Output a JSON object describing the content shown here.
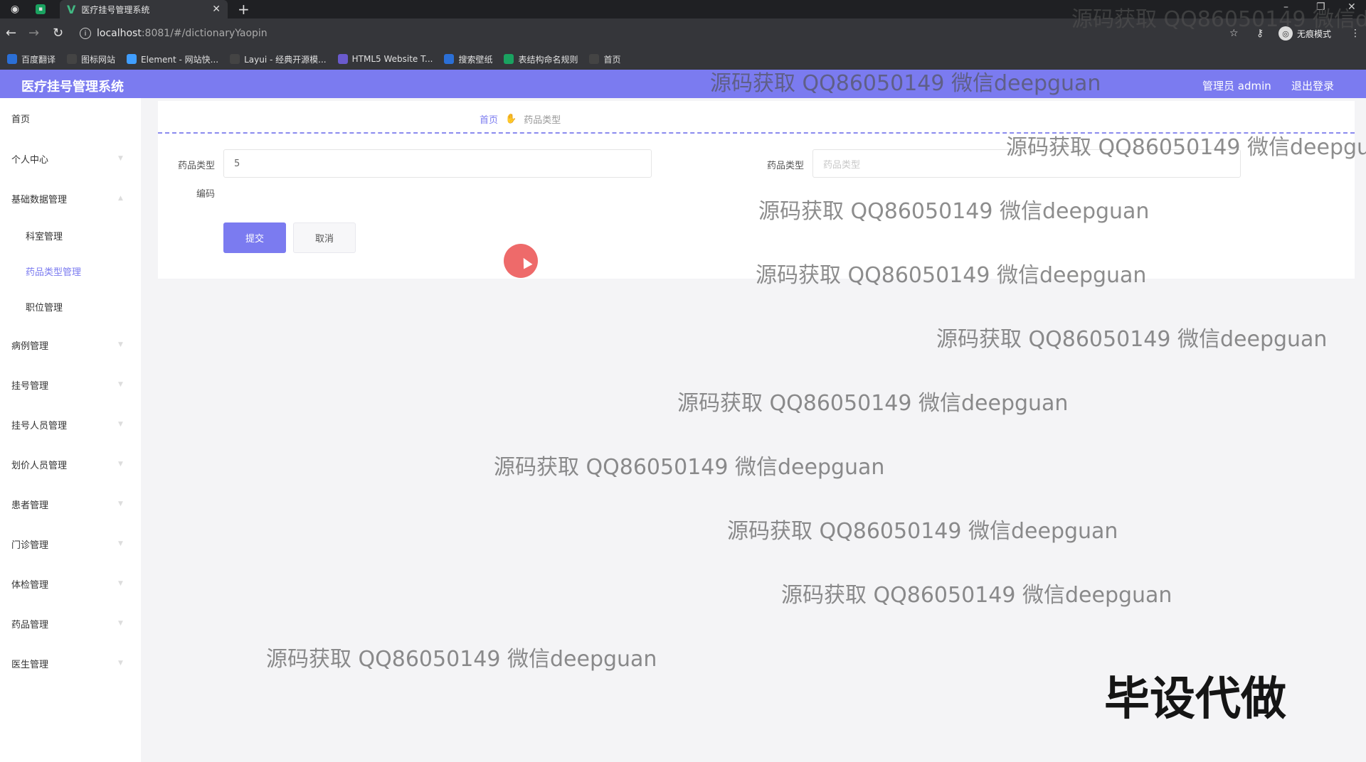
{
  "browser": {
    "tab_title": "医疗挂号管理系统",
    "url_host": "localhost",
    "url_path": ":8081/#/dictionaryYaopin",
    "incognito_label": "无痕模式",
    "bookmarks": [
      {
        "label": "百度翻译",
        "color": "#2b6fd6"
      },
      {
        "label": "图标网站",
        "color": "#444"
      },
      {
        "label": "Element - 网站快...",
        "color": "#409eff"
      },
      {
        "label": "Layui - 经典开源模...",
        "color": "#444"
      },
      {
        "label": "HTML5 Website T...",
        "color": "#6a5acd"
      },
      {
        "label": "搜索壁纸",
        "color": "#2b6fd6"
      },
      {
        "label": "表结构命名规则",
        "color": "#1aa260"
      },
      {
        "label": "首页",
        "color": "#444"
      }
    ]
  },
  "header": {
    "title": "医疗挂号管理系统",
    "user": "管理员 admin",
    "logout": "退出登录",
    "color": "#7b7bf0"
  },
  "sidebar": {
    "items": [
      "首页",
      "个人中心",
      "基础数据管理",
      "病例管理",
      "挂号管理",
      "挂号人员管理",
      "划价人员管理",
      "患者管理",
      "门诊管理",
      "体检管理",
      "药品管理",
      "医生管理"
    ],
    "sub_items": [
      "科室管理",
      "药品类型管理",
      "职位管理"
    ]
  },
  "breadcrumb": {
    "home": "首页",
    "current": "药品类型"
  },
  "form": {
    "code_label": "药品类型",
    "code_value": "5",
    "code_sub_label": "编码",
    "type_label": "药品类型",
    "type_placeholder": "药品类型",
    "submit": "提交",
    "cancel": "取消"
  },
  "watermarks": {
    "text": "源码获取 QQ86050149 微信deepguan",
    "top_text": "源码获取 QQ86050149 微信d",
    "clipped_text": "源码获取 QQ86050149 微信deepgua",
    "big": "毕设代做"
  }
}
